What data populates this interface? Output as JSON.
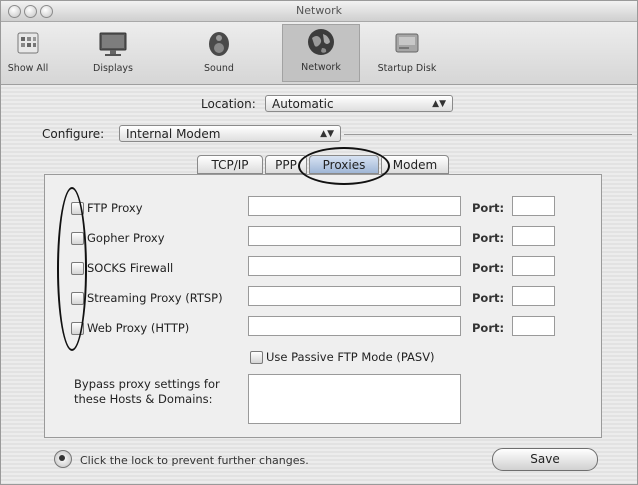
{
  "window": {
    "title": "Network"
  },
  "toolbar": {
    "items": [
      {
        "label": "Show All",
        "icon": "show-all-icon"
      },
      {
        "label": "Displays",
        "icon": "display-icon"
      },
      {
        "label": "Sound",
        "icon": "speaker-icon"
      },
      {
        "label": "Network",
        "icon": "globe-icon",
        "selected": true
      },
      {
        "label": "Startup Disk",
        "icon": "hard-disk-icon"
      }
    ]
  },
  "location": {
    "label": "Location:",
    "value": "Automatic"
  },
  "configure": {
    "label": "Configure:",
    "value": "Internal Modem"
  },
  "tabs": [
    {
      "label": "TCP/IP"
    },
    {
      "label": "PPP"
    },
    {
      "label": "Proxies",
      "active": true
    },
    {
      "label": "Modem"
    }
  ],
  "proxies": [
    {
      "label": "FTP Proxy",
      "checked": false,
      "server": "",
      "port": ""
    },
    {
      "label": "Gopher Proxy",
      "checked": false,
      "server": "",
      "port": ""
    },
    {
      "label": "SOCKS Firewall",
      "checked": false,
      "server": "",
      "port": ""
    },
    {
      "label": "Streaming Proxy (RTSP)",
      "checked": false,
      "server": "",
      "port": ""
    },
    {
      "label": "Web Proxy (HTTP)",
      "checked": false,
      "server": "",
      "port": ""
    }
  ],
  "port_label": "Port:",
  "passive_ftp": {
    "label": "Use Passive FTP Mode (PASV)",
    "checked": false
  },
  "bypass": {
    "label_line1": "Bypass proxy settings for",
    "label_line2": "these Hosts & Domains:",
    "value": ""
  },
  "footer": {
    "lock_text": "Click the lock to prevent further changes.",
    "save_label": "Save"
  },
  "colors": {
    "active_tab": "#a9bedb",
    "annotation": "#111111"
  }
}
